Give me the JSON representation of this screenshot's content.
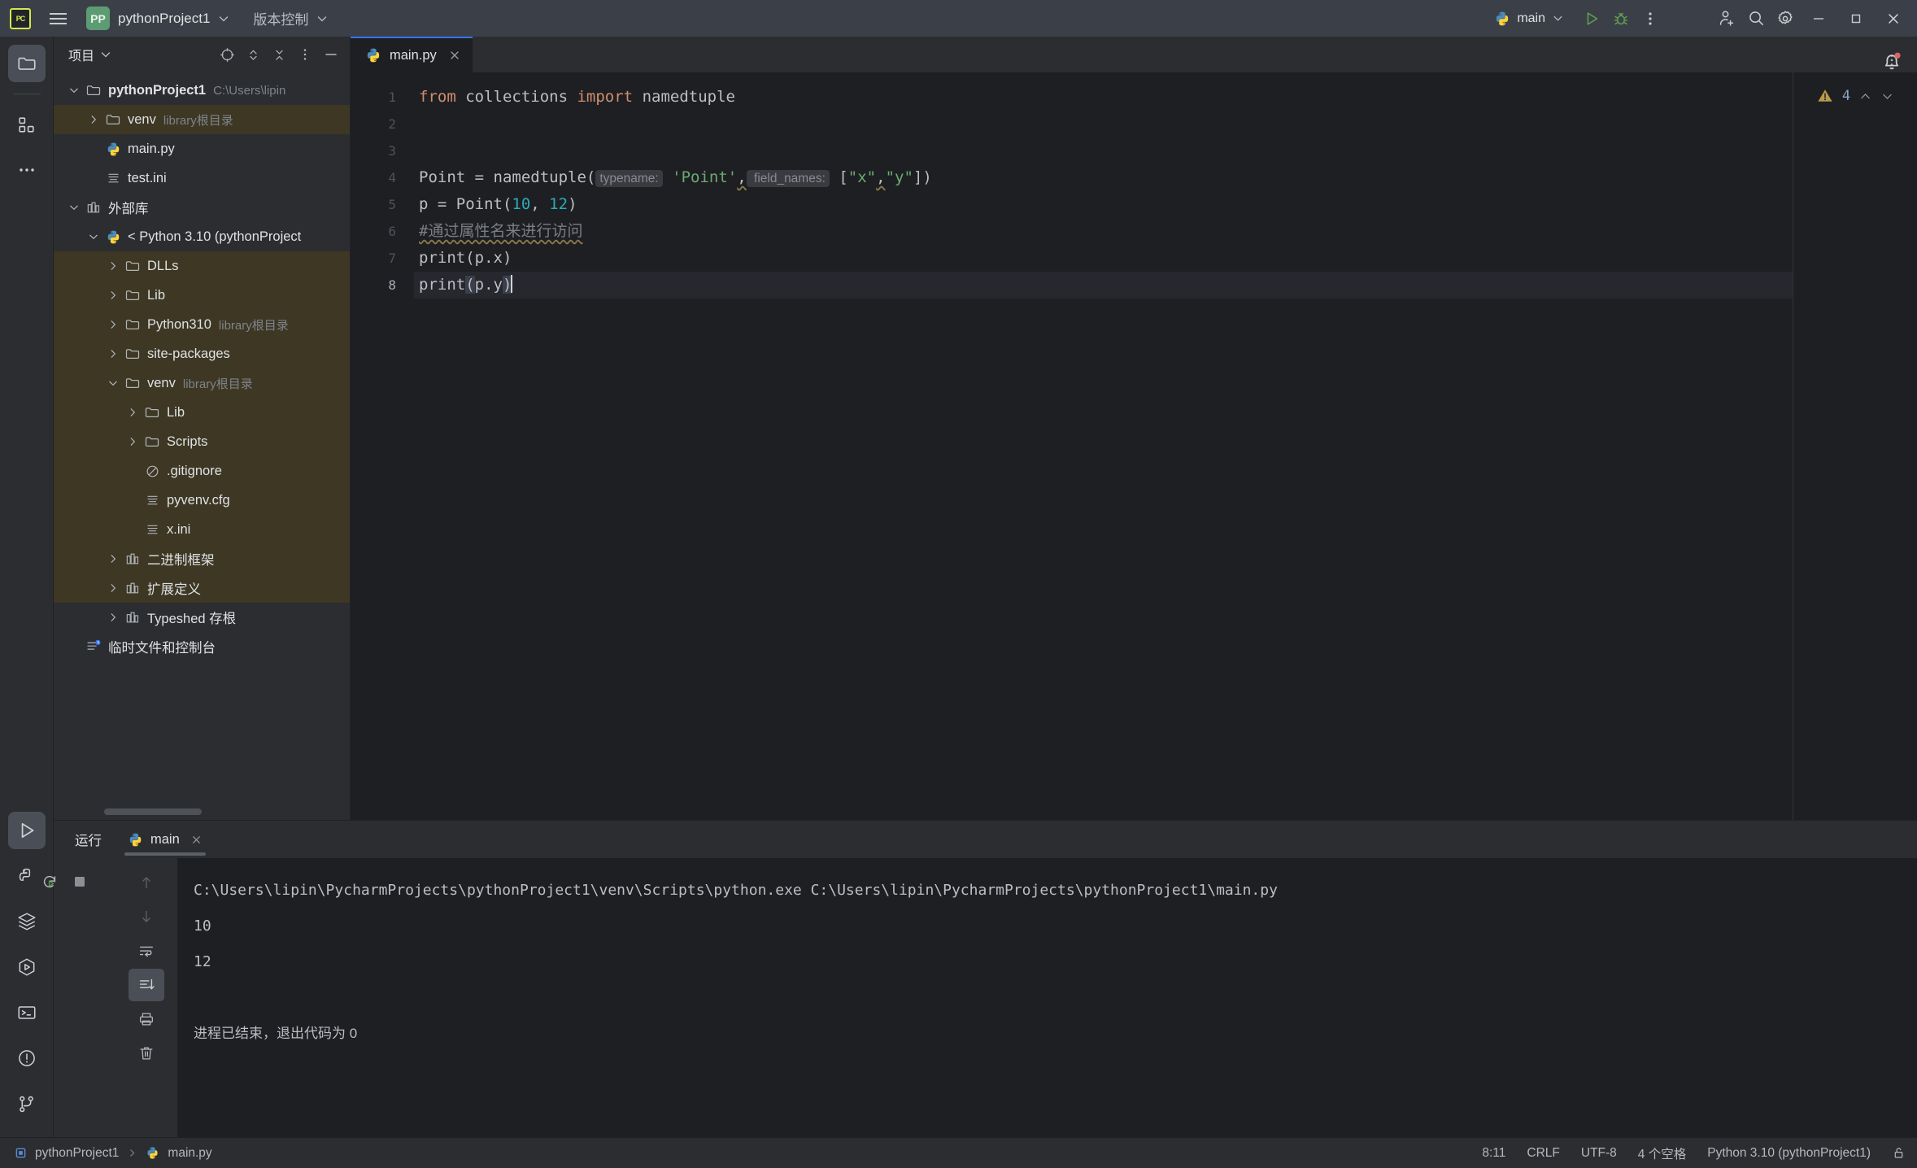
{
  "titlebar": {
    "logo_text": "PC",
    "menu_icon": "hamburger-icon",
    "project_badge": "PP",
    "project_name": "pythonProject1",
    "vcs_label": "版本控制",
    "run_config": "main",
    "run_icon": "run-icon",
    "debug_icon": "debug-icon",
    "more_icon": "more-vertical-icon",
    "share_icon": "add-user-icon",
    "search_icon": "search-icon",
    "settings_icon": "gear-icon",
    "minimize": "–",
    "maximize": "□",
    "close": "✕"
  },
  "toolstrip": {
    "top": [
      {
        "name": "project-tool-icon",
        "active": true
      },
      {
        "name": "structure-tool-icon",
        "active": false
      },
      {
        "name": "more-tools-icon",
        "active": false
      }
    ],
    "bottom": [
      {
        "name": "run-tool-icon",
        "active": true
      },
      {
        "name": "python-packages-icon",
        "active": false
      },
      {
        "name": "database-icon",
        "active": false
      },
      {
        "name": "services-icon",
        "active": false
      },
      {
        "name": "terminal-icon",
        "active": false
      },
      {
        "name": "problems-icon",
        "active": false
      },
      {
        "name": "version-control-icon",
        "active": false
      }
    ]
  },
  "project_panel": {
    "title": "项目",
    "tools": [
      "locate-icon",
      "expand-collapse-icon",
      "collapse-all-icon",
      "options-icon",
      "hide-icon"
    ],
    "tree": [
      {
        "indent": 0,
        "twist": "down",
        "icon": "folder-icon",
        "label": "pythonProject1",
        "sub": "C:\\Users\\lipin",
        "bold": true,
        "highlight": false
      },
      {
        "indent": 1,
        "twist": "right",
        "icon": "folder-icon",
        "label": "venv",
        "sub": "library根目录",
        "bold": false,
        "highlight": true
      },
      {
        "indent": 1,
        "twist": "none",
        "icon": "python-icon",
        "label": "main.py",
        "sub": "",
        "bold": false,
        "highlight": false
      },
      {
        "indent": 1,
        "twist": "none",
        "icon": "ini-icon",
        "label": "test.ini",
        "sub": "",
        "bold": false,
        "highlight": false
      },
      {
        "indent": 0,
        "twist": "down",
        "icon": "library-icon",
        "label": "外部库",
        "sub": "",
        "bold": false,
        "highlight": false
      },
      {
        "indent": 1,
        "twist": "down",
        "icon": "python-icon",
        "label": "< Python 3.10 (pythonProject",
        "sub": "",
        "bold": false,
        "highlight": false
      },
      {
        "indent": 2,
        "twist": "right",
        "icon": "folder-icon",
        "label": "DLLs",
        "sub": "",
        "bold": false,
        "highlight": true
      },
      {
        "indent": 2,
        "twist": "right",
        "icon": "folder-icon",
        "label": "Lib",
        "sub": "",
        "bold": false,
        "highlight": true
      },
      {
        "indent": 2,
        "twist": "right",
        "icon": "folder-icon",
        "label": "Python310",
        "sub": "library根目录",
        "bold": false,
        "highlight": true
      },
      {
        "indent": 2,
        "twist": "right",
        "icon": "folder-icon",
        "label": "site-packages",
        "sub": "",
        "bold": false,
        "highlight": true
      },
      {
        "indent": 2,
        "twist": "down",
        "icon": "folder-icon",
        "label": "venv",
        "sub": "library根目录",
        "bold": false,
        "highlight": true
      },
      {
        "indent": 3,
        "twist": "right",
        "icon": "folder-icon",
        "label": "Lib",
        "sub": "",
        "bold": false,
        "highlight": true
      },
      {
        "indent": 3,
        "twist": "right",
        "icon": "folder-icon",
        "label": "Scripts",
        "sub": "",
        "bold": false,
        "highlight": true
      },
      {
        "indent": 3,
        "twist": "none",
        "icon": "gitignore-icon",
        "label": ".gitignore",
        "sub": "",
        "bold": false,
        "highlight": true
      },
      {
        "indent": 3,
        "twist": "none",
        "icon": "ini-icon",
        "label": "pyvenv.cfg",
        "sub": "",
        "bold": false,
        "highlight": true
      },
      {
        "indent": 3,
        "twist": "none",
        "icon": "ini-icon",
        "label": "x.ini",
        "sub": "",
        "bold": false,
        "highlight": true
      },
      {
        "indent": 2,
        "twist": "right",
        "icon": "library-icon",
        "label": "二进制框架",
        "sub": "",
        "bold": false,
        "highlight": true
      },
      {
        "indent": 2,
        "twist": "right",
        "icon": "library-icon",
        "label": "扩展定义",
        "sub": "",
        "bold": false,
        "highlight": true
      },
      {
        "indent": 2,
        "twist": "right",
        "icon": "library-icon",
        "label": "Typeshed 存根",
        "sub": "",
        "bold": false,
        "highlight": false
      },
      {
        "indent": 0,
        "twist": "none",
        "icon": "scratches-icon",
        "label": "临时文件和控制台",
        "sub": "",
        "bold": false,
        "highlight": false
      }
    ]
  },
  "editor": {
    "tab": {
      "icon": "python-icon",
      "name": "main.py",
      "close": "✕"
    },
    "tabbar_more": "more-vertical-icon",
    "inspection": {
      "icon": "warning-icon",
      "count": "4",
      "up": "⌃",
      "down": "⌄"
    },
    "notification_icon": "bell-icon",
    "line_numbers": [
      "1",
      "2",
      "3",
      "4",
      "5",
      "6",
      "7",
      "8"
    ],
    "current_line": 8,
    "lines": [
      {
        "n": 1,
        "tokens": [
          {
            "t": "kw",
            "v": "from"
          },
          {
            "t": "id",
            "v": " collections "
          },
          {
            "t": "kw",
            "v": "import"
          },
          {
            "t": "id",
            "v": " namedtuple"
          }
        ]
      },
      {
        "n": 2,
        "tokens": []
      },
      {
        "n": 3,
        "tokens": []
      },
      {
        "n": 4,
        "tokens": [
          {
            "t": "id",
            "v": "Point = namedtuple("
          },
          {
            "t": "hint",
            "v": "typename:"
          },
          {
            "t": "str",
            "v": " 'Point'"
          },
          {
            "t": "squig",
            "v": ","
          },
          {
            "t": "hint",
            "v": " field_names:"
          },
          {
            "t": "id",
            "v": " ["
          },
          {
            "t": "str",
            "v": "\"x\""
          },
          {
            "t": "squig",
            "v": ","
          },
          {
            "t": "str",
            "v": "\"y\""
          },
          {
            "t": "id",
            "v": "])"
          }
        ]
      },
      {
        "n": 5,
        "tokens": [
          {
            "t": "id",
            "v": "p = Point("
          },
          {
            "t": "num",
            "v": "10"
          },
          {
            "t": "id",
            "v": ", "
          },
          {
            "t": "num",
            "v": "12"
          },
          {
            "t": "id",
            "v": ")"
          }
        ]
      },
      {
        "n": 6,
        "tokens": [
          {
            "t": "cmtsquig",
            "v": "#通过属性名来进行访问"
          }
        ]
      },
      {
        "n": 7,
        "tokens": [
          {
            "t": "id",
            "v": "print(p.x)"
          }
        ]
      },
      {
        "n": 8,
        "tokens": [
          {
            "t": "id",
            "v": "print"
          },
          {
            "t": "brace",
            "v": "("
          },
          {
            "t": "id",
            "v": "p.y"
          },
          {
            "t": "brace",
            "v": ")"
          },
          {
            "t": "caret",
            "v": ""
          }
        ]
      }
    ]
  },
  "run_panel": {
    "title": "运行",
    "tab": {
      "icon": "python-icon",
      "name": "main",
      "close": "✕"
    },
    "toolbar": [
      {
        "name": "rerun-icon"
      },
      {
        "name": "stop-icon"
      },
      {
        "name": "more-vertical-icon"
      }
    ],
    "side_buttons": [
      {
        "name": "scroll-up-icon",
        "active": false
      },
      {
        "name": "scroll-down-icon",
        "active": false
      },
      {
        "name": "soft-wrap-icon",
        "active": false
      },
      {
        "name": "scroll-to-end-icon",
        "active": true
      },
      {
        "name": "print-icon",
        "active": false
      },
      {
        "name": "clear-all-icon",
        "active": false
      }
    ],
    "console": [
      "C:\\Users\\lipin\\PycharmProjects\\pythonProject1\\venv\\Scripts\\python.exe C:\\Users\\lipin\\PycharmProjects\\pythonProject1\\main.py",
      "10",
      "12",
      "",
      "进程已结束，退出代码为 0"
    ]
  },
  "statusbar": {
    "breadcrumb_project": "pythonProject1",
    "breadcrumb_sep": "❯",
    "breadcrumb_file": "main.py",
    "caret_position": "8:11",
    "line_separator": "CRLF",
    "encoding": "UTF-8",
    "indent": "4 个空格",
    "interpreter": "Python 3.10 (pythonProject1)",
    "lock_icon": "unlocked-icon"
  },
  "colors": {
    "accent": "#3574f0",
    "titlebar_bg": "#3b4048",
    "panel_bg": "#2b2d30",
    "editor_bg": "#1e1f22",
    "tree_highlight": "#3d3723",
    "keyword": "#cf8e6d",
    "string": "#6aab73",
    "number": "#2aacb8",
    "comment": "#7a7e85",
    "warning": "#b89b4a"
  }
}
